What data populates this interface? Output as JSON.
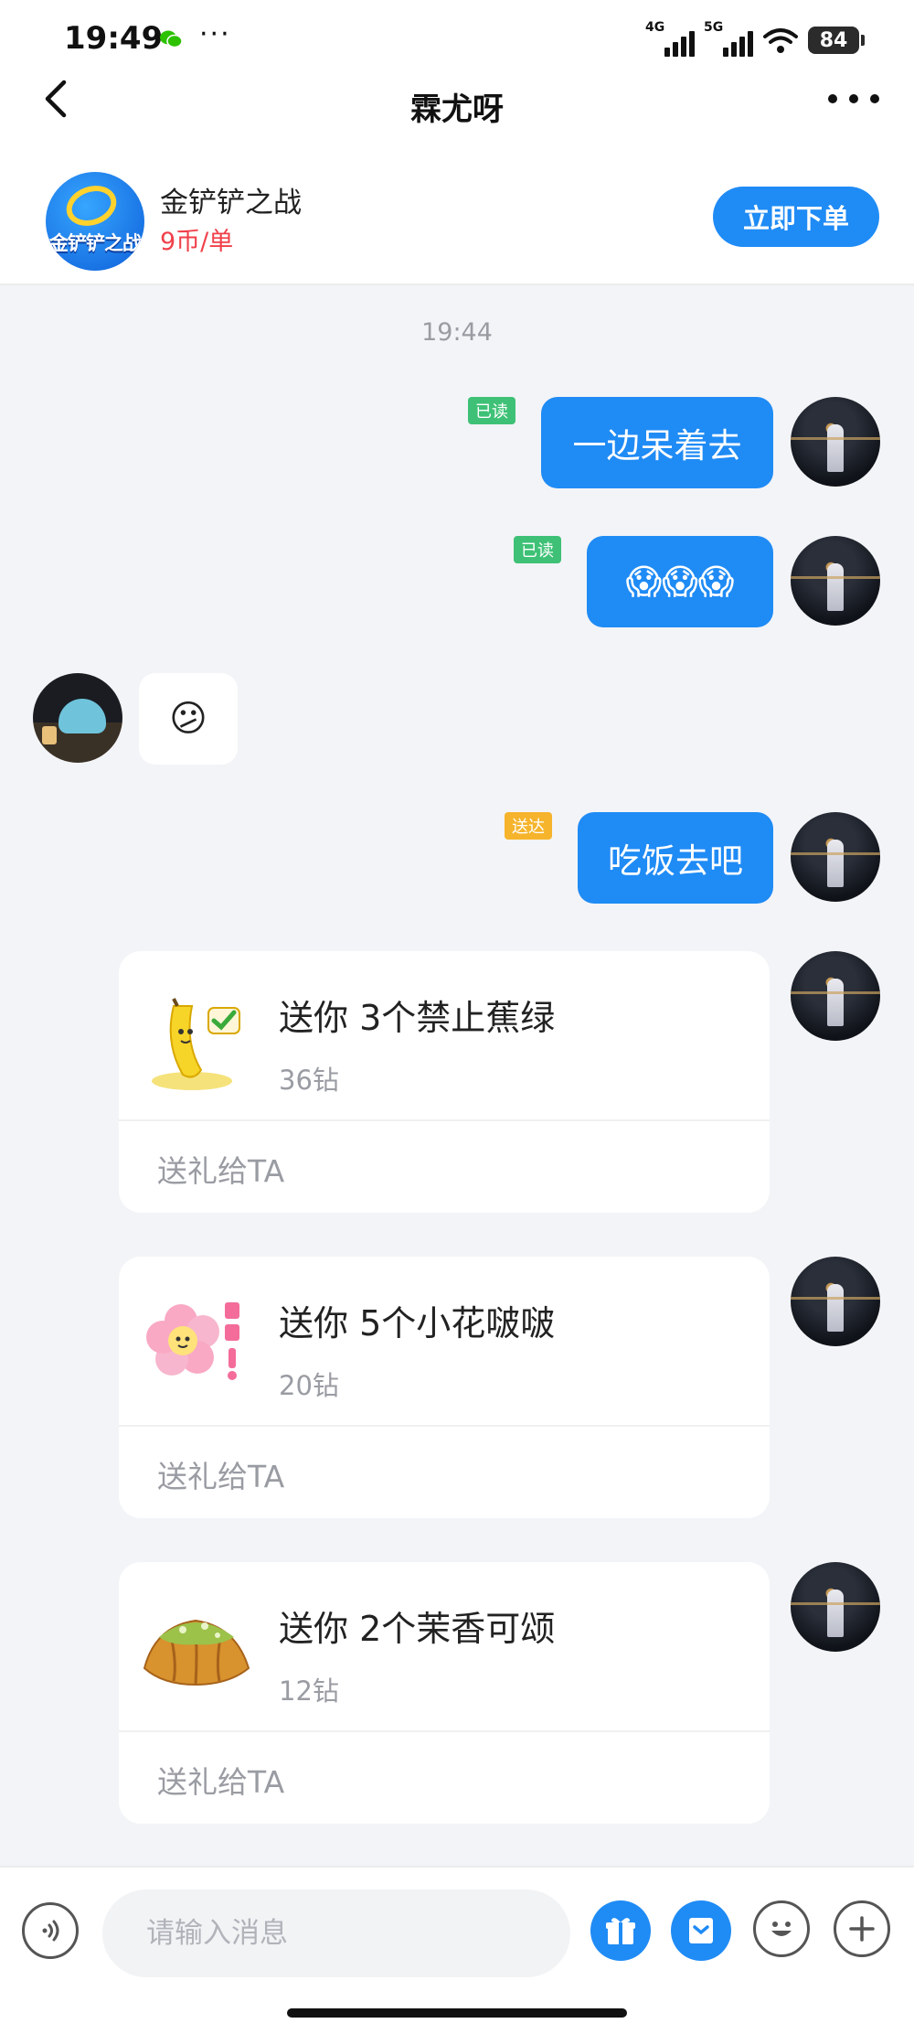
{
  "status_bar": {
    "time": "19:49",
    "dots": "···",
    "sim1_label": "4G",
    "sim2_label": "5G",
    "battery": "84",
    "icons": [
      "wechat-icon",
      "signal-icon",
      "wifi-icon",
      "battery-icon"
    ]
  },
  "nav": {
    "title": "霖尤呀",
    "back_icon": "chevron-left-icon",
    "more_icon": "more-dots-icon"
  },
  "service": {
    "logo_text": "金铲铲之战",
    "name": "金铲铲之战",
    "price": "9币/单",
    "order_button": "立即下单",
    "accent": "#1f8bf5",
    "price_color": "#f0404a"
  },
  "chat": {
    "timestamp": "19:44",
    "messages": [
      {
        "from": "me",
        "text": "一边呆着去",
        "status": "已读"
      },
      {
        "from": "me",
        "text": "😱😱😱",
        "status": "已读"
      },
      {
        "from": "other",
        "text": "😕"
      },
      {
        "from": "me",
        "text": "吃饭去吧",
        "status": "送达"
      }
    ],
    "gifts": [
      {
        "title": "送你 3个禁止蕉绿",
        "price": "36钻",
        "action": "送礼给TA",
        "icon": "banana-gift-icon"
      },
      {
        "title": "送你 5个小花啵啵",
        "price": "20钻",
        "action": "送礼给TA",
        "icon": "flower-gift-icon"
      },
      {
        "title": "送你 2个茉香可颂",
        "price": "12钻",
        "action": "送礼给TA",
        "icon": "croissant-gift-icon"
      }
    ],
    "colors": {
      "bubble_me": "#1f8bf5",
      "read_tag": "#3ec176",
      "sent_tag": "#f6b42c"
    }
  },
  "input_bar": {
    "placeholder": "请输入消息",
    "icons": [
      "voice-icon",
      "gift-icon",
      "coupon-icon",
      "emoji-icon",
      "plus-icon"
    ]
  }
}
